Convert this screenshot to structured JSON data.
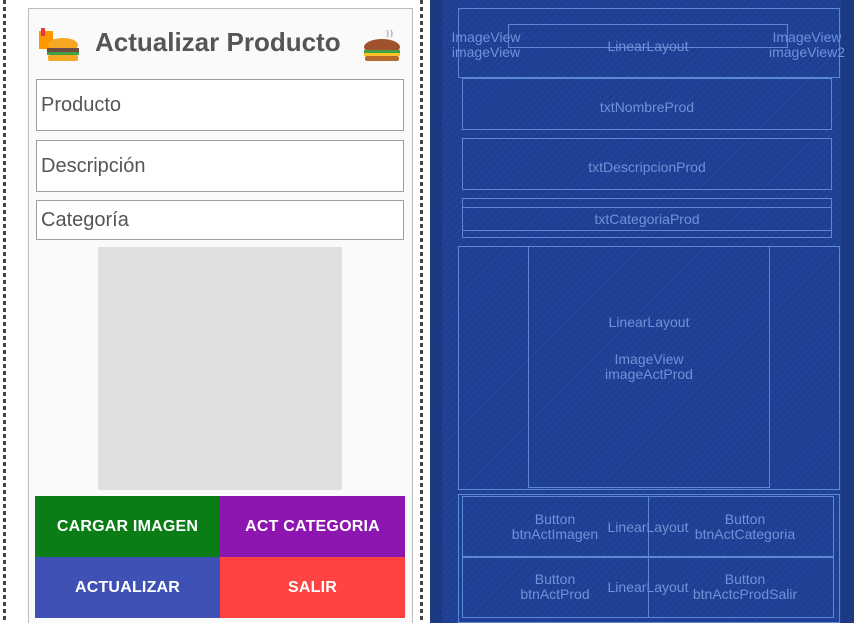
{
  "screen": {
    "title": "Actualizar Producto",
    "fields": {
      "producto_placeholder": "Producto",
      "descripcion_placeholder": "Descripción",
      "categoria_placeholder": "Categoría"
    },
    "buttons": {
      "cargar_imagen": "CARGAR IMAGEN",
      "act_categoria": "ACT CATEGORIA",
      "actualizar": "ACTUALIZAR",
      "salir": "SALIR"
    },
    "colors": {
      "cargar_imagen": "#0a7d16",
      "act_categoria": "#8e16b0",
      "actualizar": "#3f51b5",
      "salir": "#ff4343"
    },
    "icons": {
      "left": "burger-icon",
      "right": "burger-icon"
    }
  },
  "blueprint": {
    "header_left": [
      "ImageView",
      "imageView"
    ],
    "header_center": "LinearLayout",
    "header_right": [
      "ImageView",
      "imageView2"
    ],
    "field1": "txtNombreProd",
    "field2": "txtDescripcionProd",
    "field3": "txtCategoriaProd",
    "image_container": "LinearLayout",
    "image_inner": [
      "ImageView",
      "imageActProd"
    ],
    "btn1": [
      "Button",
      "btnActImagen"
    ],
    "btn2": [
      "Button",
      "btnActCategoria"
    ],
    "btn3": [
      "Button",
      "btnActProd"
    ],
    "btn4": [
      "Button",
      "btnActcProdSalir"
    ],
    "row_layout": "LinearLayout"
  }
}
